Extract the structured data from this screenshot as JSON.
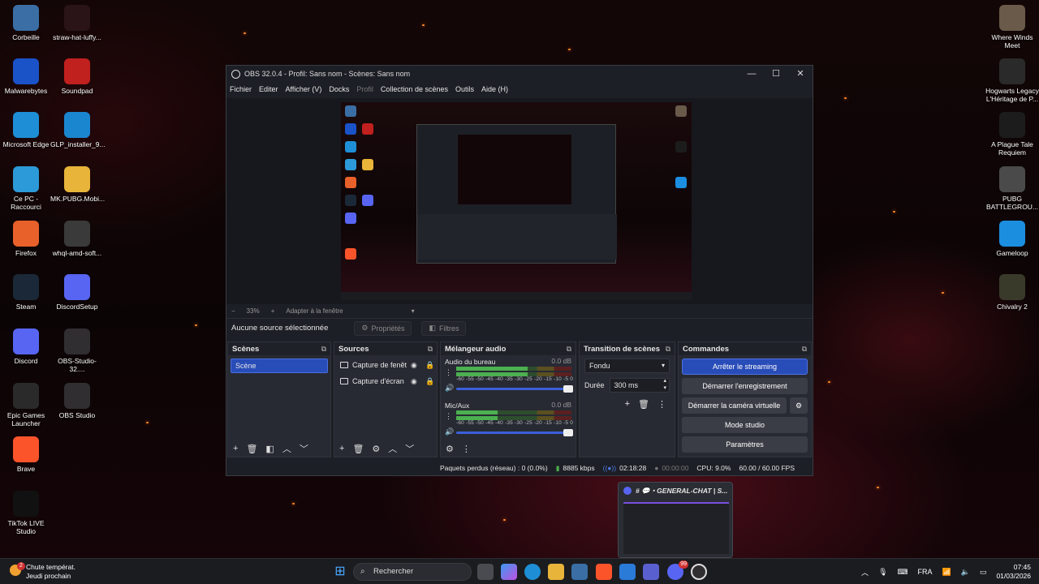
{
  "desktop": {
    "left_icons": [
      {
        "label": "Corbeille",
        "icon": "recycle-bin-icon",
        "color": "#3a6ea5"
      },
      {
        "label": "straw-hat-luffy...",
        "icon": "luffy-icon",
        "color": "#2a1418"
      },
      {
        "label": "Malwarebytes",
        "icon": "malwarebytes-icon",
        "color": "#1a52c8"
      },
      {
        "label": "Soundpad",
        "icon": "soundpad-icon",
        "color": "#c0201e"
      },
      {
        "label": "Microsoft Edge",
        "icon": "edge-icon",
        "color": "#1e8fd6"
      },
      {
        "label": "GLP_installer_9...",
        "icon": "glp-icon",
        "color": "#1a86d0"
      },
      {
        "label": "Ce PC - Raccourci",
        "icon": "pc-icon",
        "color": "#2c9ad8"
      },
      {
        "label": "MK.PUBG.Mobi...",
        "icon": "folder-icon",
        "color": "#e8b43a"
      },
      {
        "label": "Firefox",
        "icon": "firefox-icon",
        "color": "#e8602a"
      },
      {
        "label": "whql-amd-soft...",
        "icon": "amd-icon",
        "color": "#3a3a3a"
      },
      {
        "label": "Steam",
        "icon": "steam-icon",
        "color": "#1b2838"
      },
      {
        "label": "DiscordSetup",
        "icon": "discord-icon",
        "color": "#5865f2"
      },
      {
        "label": "Discord",
        "icon": "discord-icon",
        "color": "#5865f2"
      },
      {
        "label": "OBS-Studio-32....",
        "icon": "obs-icon",
        "color": "#302e31"
      },
      {
        "label": "Epic Games Launcher",
        "icon": "epic-icon",
        "color": "#2a2a2a"
      },
      {
        "label": "OBS Studio",
        "icon": "obs-icon",
        "color": "#302e31"
      },
      {
        "label": "Brave",
        "icon": "brave-icon",
        "color": "#fb542b"
      },
      {
        "label": "TikTok LIVE Studio",
        "icon": "tiktok-icon",
        "color": "#111111"
      }
    ],
    "right_icons": [
      {
        "label": "Where Winds Meet",
        "icon": "where-winds-meet-icon",
        "color": "#6a5a4a"
      },
      {
        "label": "Hogwarts Legacy L'Héritage de P...",
        "icon": "hogwarts-icon",
        "color": "#2a2a2a"
      },
      {
        "label": "A Plague Tale Requiem",
        "icon": "plague-tale-icon",
        "color": "#1c1c1c"
      },
      {
        "label": "PUBG BATTLEGROU...",
        "icon": "pubg-icon",
        "color": "#4a4a4a"
      },
      {
        "label": "Gameloop",
        "icon": "gameloop-icon",
        "color": "#1c8ee0"
      },
      {
        "label": "Chivalry 2",
        "icon": "chivalry-icon",
        "color": "#3a3a2a"
      }
    ]
  },
  "obs": {
    "title": "OBS 32.0.4 - Profil: Sans nom - Scènes: Sans nom",
    "menu": [
      "Fichier",
      "Editer",
      "Afficher (V)",
      "Docks",
      "Profil",
      "Collection de scènes",
      "Outils",
      "Aide (H)"
    ],
    "zoom": {
      "minus": "−",
      "value": "33%",
      "plus": "+",
      "fit": "Adapter à la fenêtre"
    },
    "no_source": "Aucune source sélectionnée",
    "properties": "Propriétés",
    "filters": "Filtres",
    "scenes": {
      "title": "Scènes",
      "items": [
        "Scène"
      ]
    },
    "sources": {
      "title": "Sources",
      "items": [
        "Capture de fenêt",
        "Capture d'écran"
      ]
    },
    "mixer": {
      "title": "Mélangeur audio",
      "scale": "-60 -55 -50 -45 -40 -35 -30 -25 -20 -15 -10 -5 0",
      "channels": [
        {
          "name": "Audio du bureau",
          "db": "0.0 dB",
          "level": 0.62
        },
        {
          "name": "Mic/Aux",
          "db": "0.0 dB",
          "level": 0.36
        }
      ]
    },
    "transition": {
      "title": "Transition de scènes",
      "type": "Fondu",
      "duration_label": "Durée",
      "duration": "300 ms"
    },
    "controls": {
      "title": "Commandes",
      "stop_streaming": "Arrêter le streaming",
      "start_recording": "Démarrer l'enregistrement",
      "start_virtual_cam": "Démarrer la caméra virtuelle",
      "studio_mode": "Mode studio",
      "settings": "Paramètres"
    },
    "status": {
      "dropped": "Paquets perdus (réseau) : 0 (0.0%)",
      "bitrate": "8885 kbps",
      "stream_time": "02:18:28",
      "rec_time": "00:00:00",
      "cpu": "CPU: 9.0%",
      "fps": "60.00 / 60.00 FPS"
    }
  },
  "discord_preview": {
    "title": "# 💬・GENERAL-CHAT | S..."
  },
  "taskbar": {
    "weather_title": "Chute températ.",
    "weather_sub": "Jeudi prochain",
    "weather_badge": "2",
    "search": "Rechercher",
    "lang": "FRA",
    "time": "07:45",
    "date": "01/03/2026",
    "discord_badge": "99"
  },
  "colors": {
    "accent": "#284cb8",
    "meter_green": "#4caf50",
    "meter_yellow": "#c9a227",
    "meter_red": "#c0392b"
  }
}
